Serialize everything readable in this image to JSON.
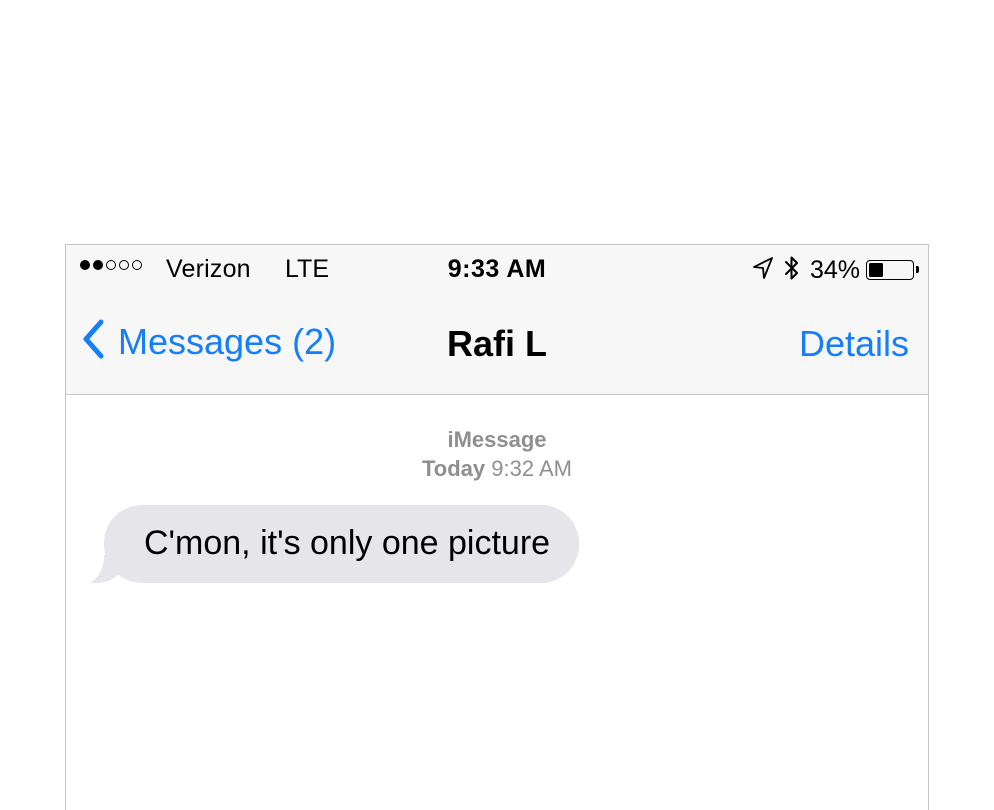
{
  "status_bar": {
    "signal_strength": "2 of 5 bars",
    "carrier": "Verizon",
    "network": "LTE",
    "time": "9:33 AM",
    "battery_percent": "34%",
    "battery_level": 0.34,
    "icons": [
      "location-arrow-icon",
      "bluetooth-icon",
      "battery-icon"
    ]
  },
  "nav_bar": {
    "back_label": "Messages (2)",
    "title": "Rafi L",
    "details_label": "Details"
  },
  "conversation": {
    "service": "iMessage",
    "timestamp_day": "Today",
    "timestamp_time": "9:32 AM",
    "messages": [
      {
        "direction": "incoming",
        "text": "C'mon, it's only one picture"
      }
    ]
  },
  "colors": {
    "accent": "#147efb",
    "incoming_bubble": "#e5e5ea",
    "meta_text": "#8e8e93",
    "bar_background": "#f7f7f7"
  }
}
